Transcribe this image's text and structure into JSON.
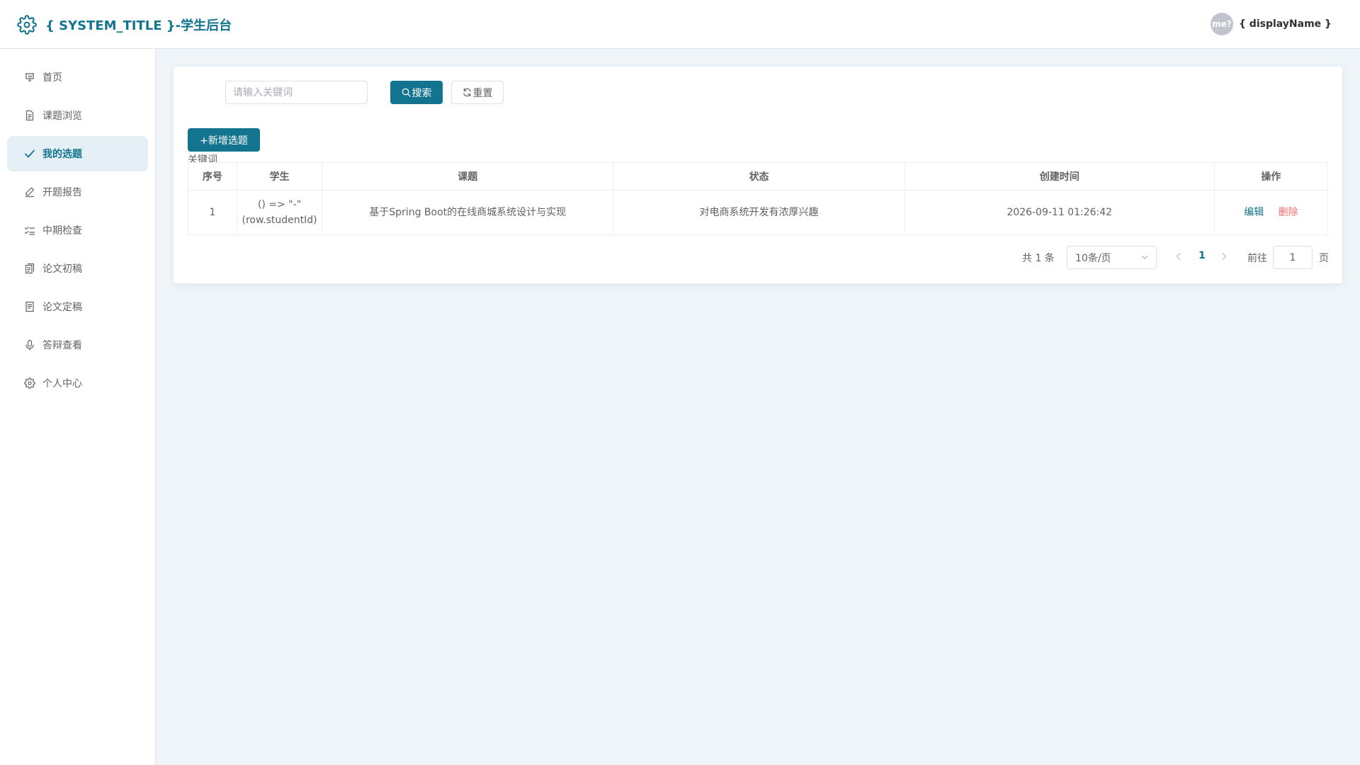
{
  "header": {
    "title": "{ SYSTEM_TITLE }-学生后台",
    "avatar_text": "me?",
    "display_name": "{ displayName }"
  },
  "sidebar": {
    "items": [
      {
        "label": "首页",
        "icon": "presentation-icon"
      },
      {
        "label": "课题浏览",
        "icon": "document-icon"
      },
      {
        "label": "我的选题",
        "icon": "check-icon",
        "active": true
      },
      {
        "label": "开题报告",
        "icon": "edit-pen-icon"
      },
      {
        "label": "中期检查",
        "icon": "checklist-icon"
      },
      {
        "label": "论文初稿",
        "icon": "copy-document-icon"
      },
      {
        "label": "论文定稿",
        "icon": "final-document-icon"
      },
      {
        "label": "答辩查看",
        "icon": "microphone-icon"
      },
      {
        "label": "个人中心",
        "icon": "gear-icon"
      }
    ]
  },
  "filter": {
    "keyword_label": "关键词",
    "keyword_placeholder": "请输入关键词",
    "keyword_value": "",
    "search_label": "搜索",
    "reset_label": "重置"
  },
  "toolbar": {
    "add_label": "+新增选题"
  },
  "table": {
    "columns": [
      "序号",
      "学生",
      "课题",
      "状态",
      "创建时间",
      "操作"
    ],
    "rows": [
      {
        "index": "1",
        "student_line1": "() => \"-\"",
        "student_line2": "(row.studentId)",
        "topic": "基于Spring Boot的在线商城系统设计与实现",
        "status": "对电商系统开发有浓厚兴趣",
        "created": "2026-09-11 01:26:42",
        "edit_label": "编辑",
        "delete_label": "删除"
      }
    ]
  },
  "pagination": {
    "total_text": "共 1 条",
    "page_size_text": "10条/页",
    "current_page": "1",
    "goto_label": "前往",
    "goto_value": "1",
    "page_suffix": "页"
  },
  "colors": {
    "accent": "#12748e",
    "danger": "#f56c6c",
    "background": "#f0f5f9",
    "active_bg": "#e4f0f5"
  }
}
